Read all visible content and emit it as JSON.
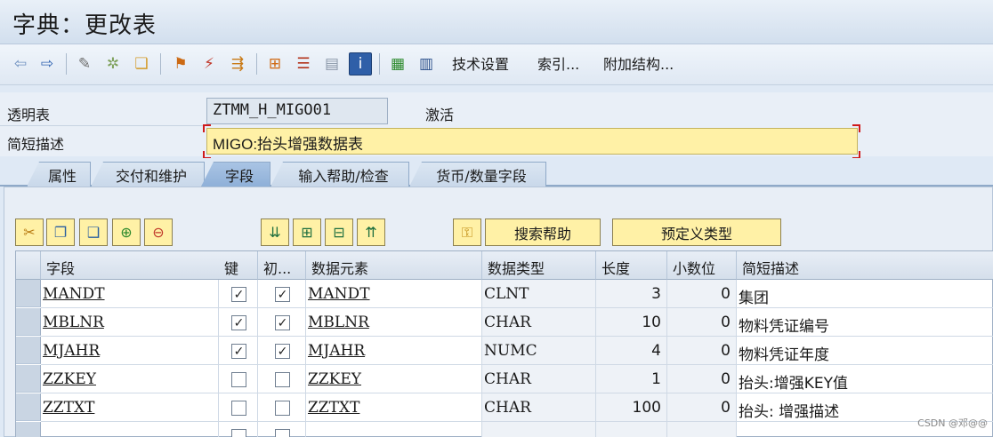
{
  "title": "字典：更改表",
  "toolbar": {
    "tech_settings": "技术设置",
    "index": "索引...",
    "append_structure": "附加结构..."
  },
  "form": {
    "transparent_table_label": "透明表",
    "table_name": "ZTMM_H_MIGO01",
    "status": "激活",
    "short_desc_label": "简短描述",
    "short_desc_value": "MIGO:抬头增强数据表"
  },
  "tabs": [
    "属性",
    "交付和维护",
    "字段",
    "输入帮助/检查",
    "货币/数量字段"
  ],
  "active_tab": "字段",
  "buttons": {
    "search_help": "搜索帮助",
    "predefined_type": "预定义类型"
  },
  "grid": {
    "headers": [
      "字段",
      "键",
      "初...",
      "数据元素",
      "数据类型",
      "长度",
      "小数位",
      "简短描述"
    ],
    "rows": [
      {
        "field": "MANDT",
        "key": true,
        "init": true,
        "element": "MANDT",
        "type": "CLNT",
        "length": "3",
        "decimals": "0",
        "desc": "集团"
      },
      {
        "field": "MBLNR",
        "key": true,
        "init": true,
        "element": "MBLNR",
        "type": "CHAR",
        "length": "10",
        "decimals": "0",
        "desc": "物料凭证编号"
      },
      {
        "field": "MJAHR",
        "key": true,
        "init": true,
        "element": "MJAHR",
        "type": "NUMC",
        "length": "4",
        "decimals": "0",
        "desc": "物料凭证年度"
      },
      {
        "field": "ZZKEY",
        "key": false,
        "init": false,
        "element": "ZZKEY",
        "type": "CHAR",
        "length": "1",
        "decimals": "0",
        "desc": "抬头:增强KEY值"
      },
      {
        "field": "ZZTXT",
        "key": false,
        "init": false,
        "element": "ZZTXT",
        "type": "CHAR",
        "length": "100",
        "decimals": "0",
        "desc": "抬头:  增强描述"
      }
    ]
  },
  "watermark": "CSDN @邓@@"
}
